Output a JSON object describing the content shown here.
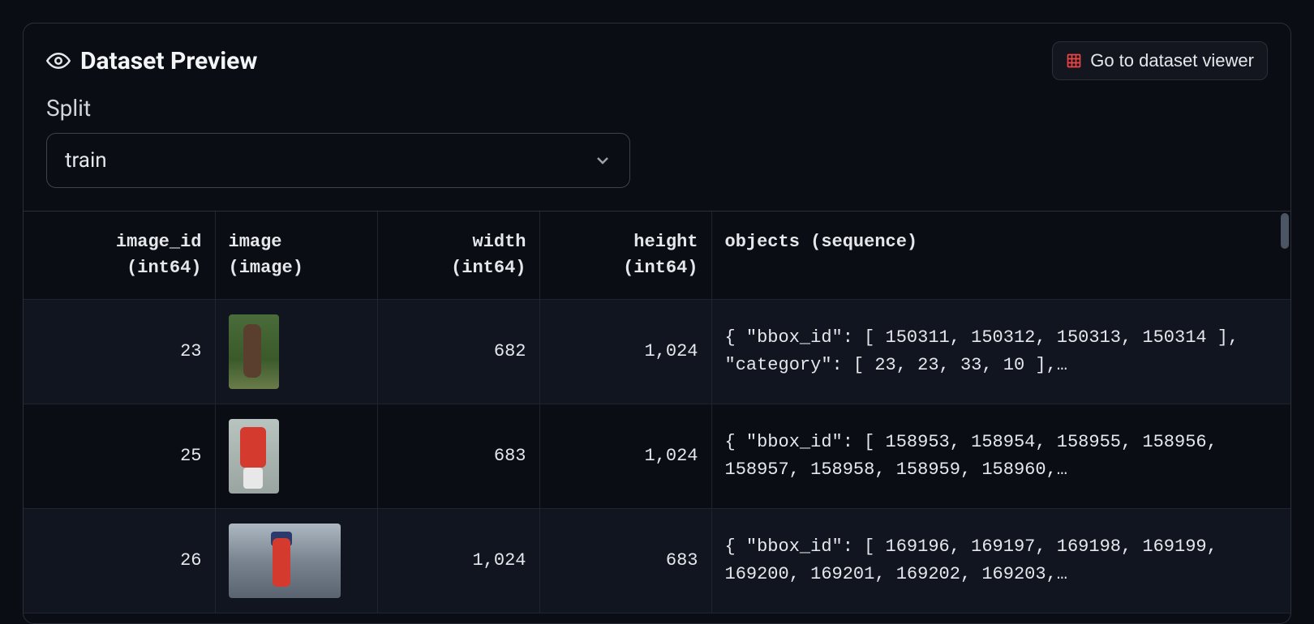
{
  "header": {
    "title": "Dataset Preview",
    "viewer_button": "Go to dataset viewer"
  },
  "split": {
    "label": "Split",
    "selected": "train"
  },
  "table": {
    "columns": [
      {
        "name": "image_id",
        "type": "(int64)",
        "align": "right"
      },
      {
        "name": "image",
        "type": "(image)",
        "align": "left"
      },
      {
        "name": "width",
        "type": "(int64)",
        "align": "right"
      },
      {
        "name": "height",
        "type": "(int64)",
        "align": "right"
      },
      {
        "name": "objects (sequence)",
        "type": "",
        "align": "left"
      }
    ],
    "rows": [
      {
        "image_id": "23",
        "width": "682",
        "height": "1,024",
        "objects": "{ \"bbox_id\": [ 150311, 150312, 150313, 150314 ], \"category\": [ 23, 23, 33, 10 ],…"
      },
      {
        "image_id": "25",
        "width": "683",
        "height": "1,024",
        "objects": "{ \"bbox_id\": [ 158953, 158954, 158955, 158956, 158957, 158958, 158959, 158960,…"
      },
      {
        "image_id": "26",
        "width": "1,024",
        "height": "683",
        "objects": "{ \"bbox_id\": [ 169196, 169197, 169198, 169199, 169200, 169201, 169202, 169203,…"
      }
    ]
  }
}
